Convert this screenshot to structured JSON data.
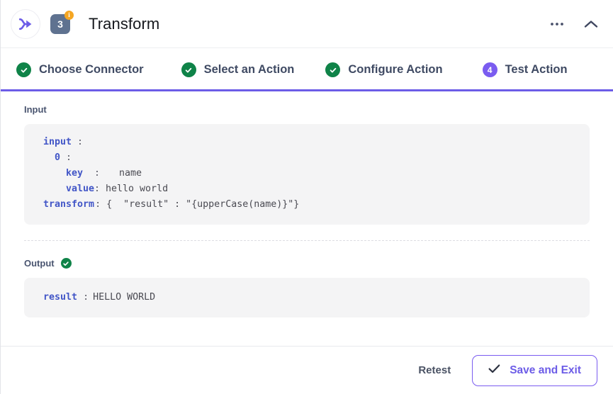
{
  "header": {
    "app_icon": "transform-arrow-icon",
    "step_badge": "3",
    "info_badge": "i",
    "title": "Transform",
    "more_icon": "ellipsis-icon",
    "collapse_icon": "chevron-up-icon"
  },
  "stepper": {
    "accent_color": "#6c5ce7",
    "steps": [
      {
        "label": "Choose Connector",
        "state": "done",
        "mark": "check-icon"
      },
      {
        "label": "Select an Action",
        "state": "done",
        "mark": "check-icon"
      },
      {
        "label": "Configure Action",
        "state": "done",
        "mark": "check-icon"
      },
      {
        "label": "Test Action",
        "state": "active",
        "mark": "4"
      }
    ]
  },
  "input_section": {
    "label": "Input",
    "lines": {
      "l1_key": "input",
      "l1_colon": ":",
      "l2_key": "0",
      "l2_colon": ":",
      "l3_key": "key",
      "l3_colon": ":",
      "l3_value": "name",
      "l4_key": "value",
      "l4_colon": ":",
      "l4_value": "hello world",
      "l5_key": "transform",
      "l5_colon": ":",
      "l5_value": "{  \"result\" : \"{upperCase(name)}\"}"
    }
  },
  "output_section": {
    "label": "Output",
    "status_icon": "check-icon",
    "result_key": "result",
    "result_colon": ":",
    "result_value": "HELLO WORLD"
  },
  "footer": {
    "retest_label": "Retest",
    "save_label": "Save and Exit",
    "save_icon": "check-mark-icon"
  }
}
